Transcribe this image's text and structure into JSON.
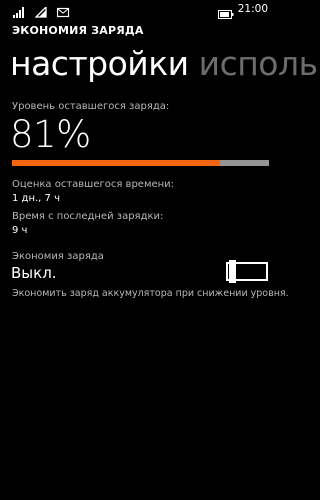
{
  "status_bar": {
    "time": "21:00",
    "icons": [
      "signal-icon",
      "wifi-icon",
      "message-icon",
      "battery-icon"
    ]
  },
  "app_title": "ЭКОНОМИЯ ЗАРЯДА",
  "pivot": {
    "tabs": [
      {
        "label": "настройки",
        "active": true
      },
      {
        "label": "исполь",
        "active": false
      }
    ]
  },
  "battery": {
    "remaining_label": "Уровень оставшегося заряда:",
    "percent_text": "81%",
    "level": 0.81,
    "fill_color": "#f2660f",
    "track_color": "#959595"
  },
  "estimate": {
    "label": "Оценка оставшегося времени:",
    "value": "1 дн., 7 ч"
  },
  "since_charge": {
    "label": "Время с последней зарядки:",
    "value": "9 ч"
  },
  "battery_saver": {
    "label": "Экономия заряда",
    "state_text": "Выкл.",
    "on": false,
    "description": "Экономить заряд аккумулятора при снижении уровня."
  }
}
